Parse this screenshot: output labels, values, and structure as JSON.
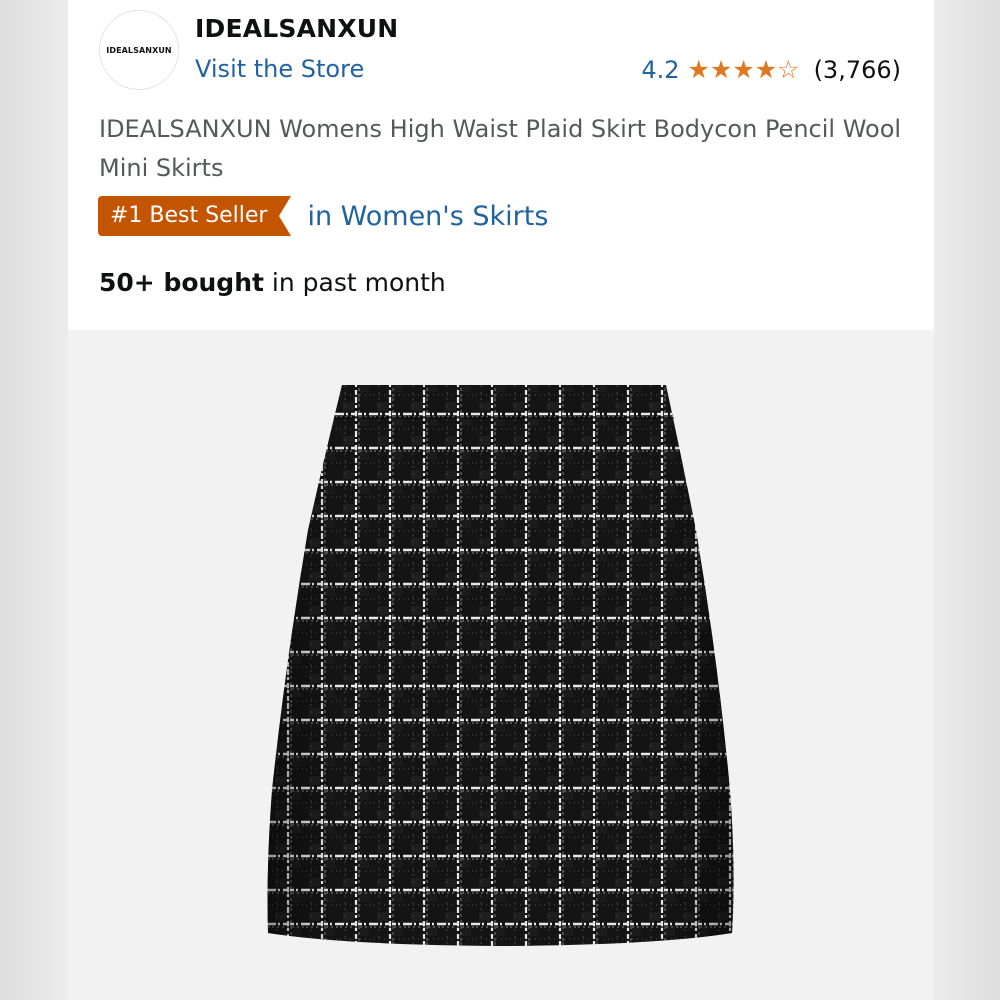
{
  "store": {
    "logo_text": "IDEALSANXUN",
    "brand_name": "IDEALSANXUN",
    "visit_store_label": "Visit the Store"
  },
  "rating": {
    "value": "4.2",
    "stars": "★★★★☆",
    "stars_value": 4.2,
    "review_count": "(3,766)"
  },
  "product": {
    "title": "IDEALSANXUN Womens High Waist Plaid Skirt Bodycon Pencil Wool Mini Skirts",
    "badge_label": "#1 Best Seller",
    "category_link": "in Women's Skirts",
    "bought_bold": "50+ bought",
    "bought_rest": " in past month"
  },
  "image": {
    "subject": "black-white-tweed-plaid-mini-skirt"
  },
  "colors": {
    "link": "#2162a1",
    "star": "#de7921",
    "badge": "#c45500",
    "text": "#0f1111",
    "muted": "#565959"
  }
}
